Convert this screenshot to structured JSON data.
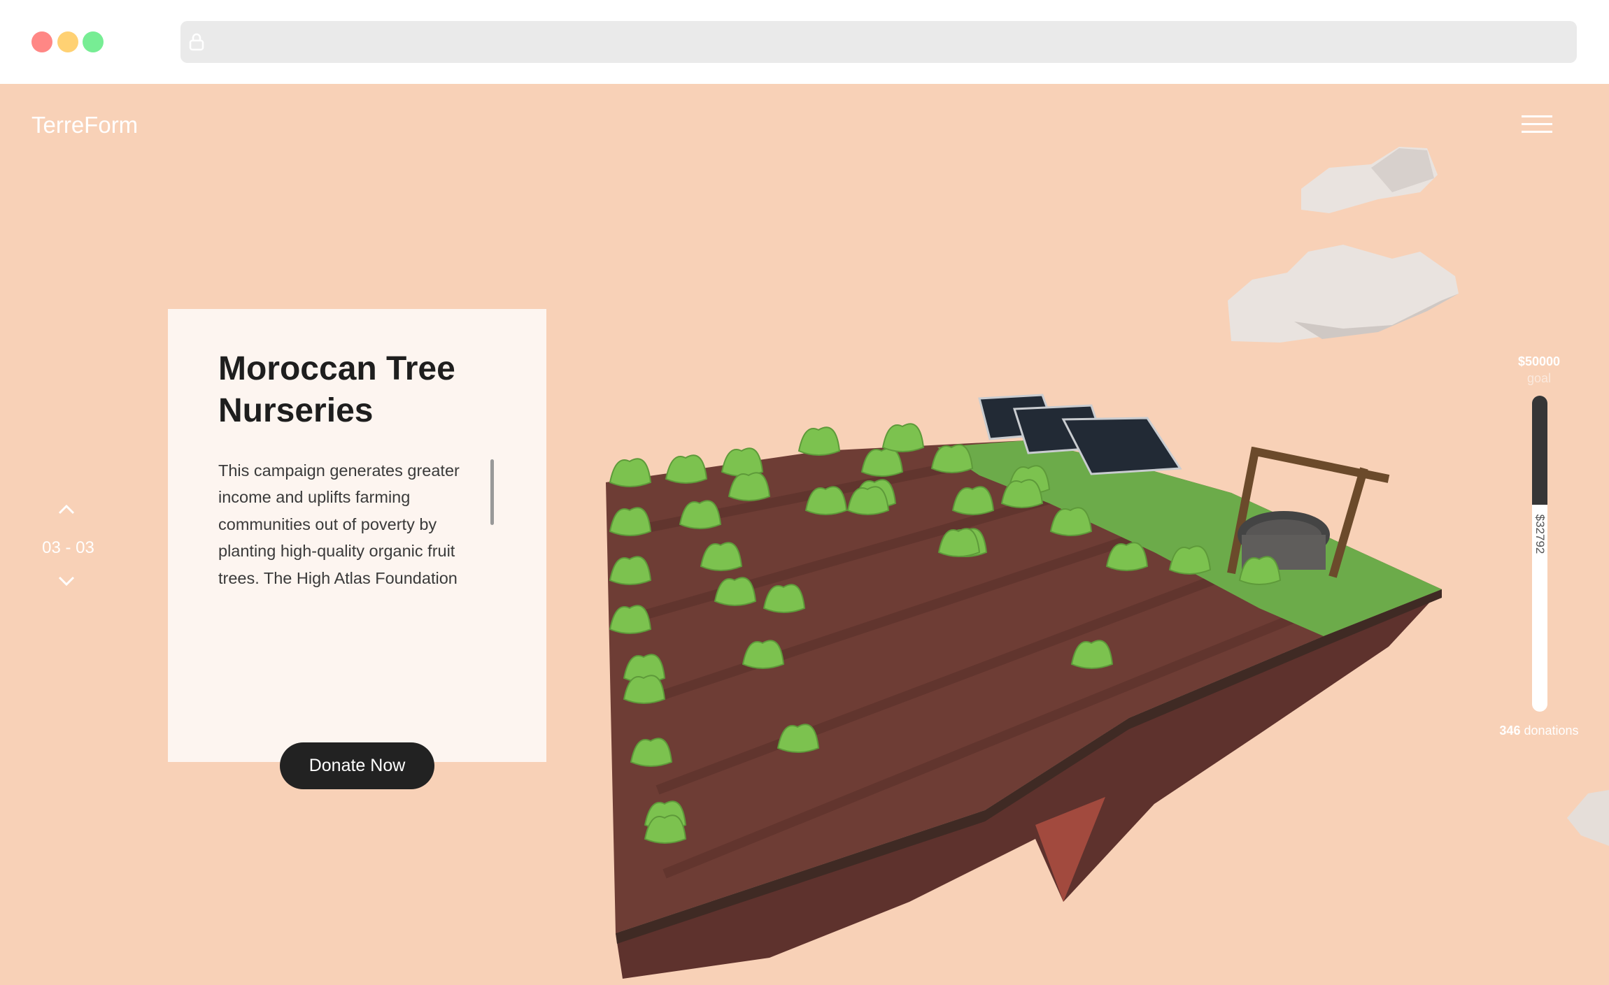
{
  "browser": {
    "dots": [
      "#ff8785",
      "#ffd173",
      "#77ed94"
    ],
    "url": ""
  },
  "header": {
    "logo": "TerreForm",
    "menu_icon": "hamburger-icon"
  },
  "pager": {
    "current": "03 - 03"
  },
  "campaign": {
    "title": "Moroccan Tree Nurseries",
    "description": "This campaign generates greater income and uplifts farming communities out of poverty by planting high-quality organic fruit trees. The High Atlas Foundation (HAF) and cooperatives raise the",
    "donate_label": "Donate Now"
  },
  "progress": {
    "goal_amount": "$50000",
    "goal_label": "goal",
    "raised": "$32792",
    "raised_fraction": 0.6558,
    "donation_count": "346",
    "donation_label": "donations"
  },
  "colors": {
    "background": "#f8d1b7",
    "card": "#fdf5f0",
    "accent_dark": "#222222",
    "soil": "#6b3a33",
    "grass": "#6cab4a"
  }
}
